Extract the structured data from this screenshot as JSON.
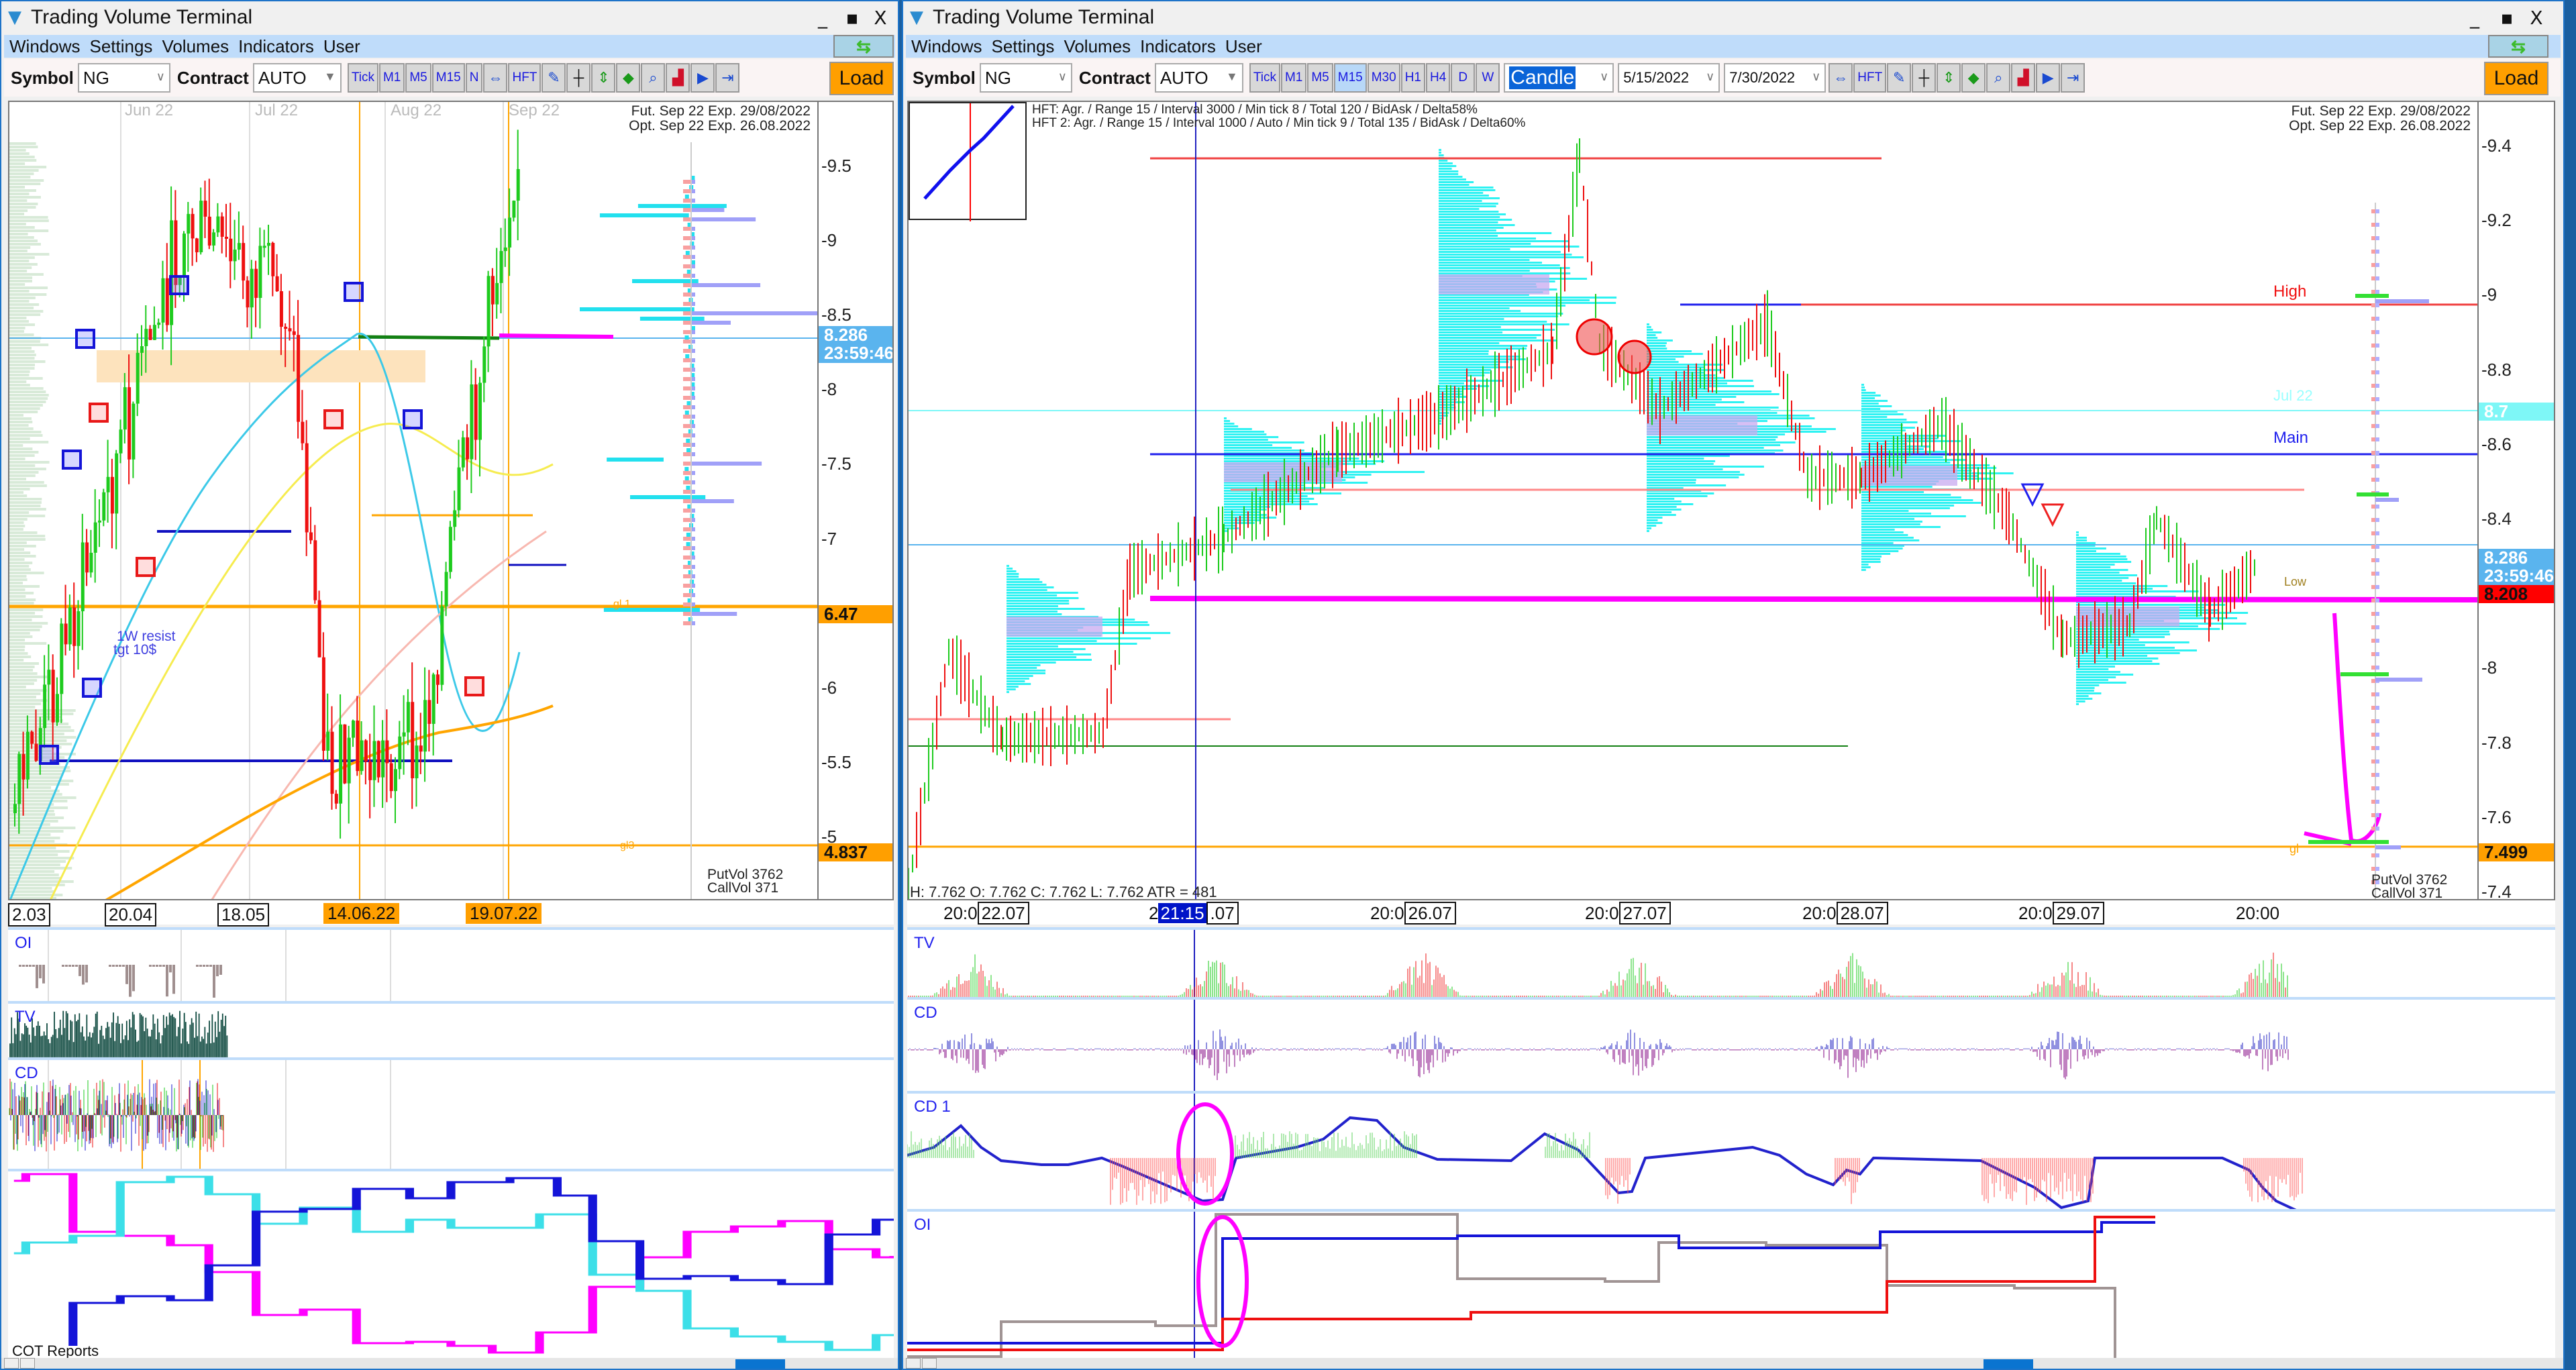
{
  "app_title": "Trading Volume Terminal",
  "window_controls": {
    "minimize": "_",
    "maximize": "▪",
    "close": "X"
  },
  "menu": [
    "Windows",
    "Settings",
    "Volumes",
    "Indicators",
    "User"
  ],
  "left": {
    "toolbar": {
      "symbol_label": "Symbol",
      "symbol_value": "NG",
      "contract_label": "Contract",
      "contract_value": "AUTO",
      "timeframes": [
        "Tick",
        "M1",
        "M5",
        "M15",
        "N"
      ],
      "hft_label": "HFT",
      "load_label": "Load"
    },
    "chart": {
      "month_labels": [
        "Jun 22",
        "Jul 22",
        "Aug 22",
        "Sep 22"
      ],
      "expiry_fut": "Fut. Sep 22 Exp. 29/08/2022",
      "expiry_opt": "Opt. Sep 22 Exp. 26.08.2022",
      "price_ticks": [
        "9.5",
        "9",
        "8.5",
        "8",
        "7.5",
        "7",
        "6.5",
        "6",
        "5.5",
        "5"
      ],
      "current_price": "8.286",
      "countdown": "23:59:46",
      "level_orange_1": "6.47",
      "level_orange_2": "4.837",
      "annotation_1": "1W resist",
      "annotation_2": "tgt 10$",
      "level_label_gl1": "gl 1",
      "level_label_gl3": "gl3",
      "put_vol": "PutVol  3762",
      "call_vol": "CallVol  371",
      "time_labels": [
        "2.03",
        "20.04",
        "18.05",
        "14.06.22",
        "19.07.22"
      ]
    },
    "panels": {
      "oi": "OI",
      "tv": "TV",
      "cd": "CD",
      "cot": "COT Reports"
    }
  },
  "right": {
    "toolbar": {
      "symbol_label": "Symbol",
      "symbol_value": "NG",
      "contract_label": "Contract",
      "contract_value": "AUTO",
      "timeframes": [
        "Tick",
        "M1",
        "M5",
        "M15",
        "M30",
        "H1",
        "H4",
        "D",
        "W"
      ],
      "active_timeframe": "M15",
      "chart_type": "Candle",
      "date_from": "5/15/2022",
      "date_to": "7/30/2022",
      "hft_label": "HFT",
      "load_label": "Load"
    },
    "chart": {
      "hft_line_1": "HFT: Agr. / Range 15 / Interval 3000 / Min tick 8 / Total 120 / BidAsk / Delta58%",
      "hft_line_2": "HFT 2: Agr. / Range 15 / Interval 1000 / Auto / Min tick 9 / Total 135 / BidAsk / Delta60%",
      "expiry_fut": "Fut. Sep 22 Exp. 29/08/2022",
      "expiry_opt": "Opt. Sep 22 Exp. 26.08.2022",
      "price_ticks": [
        "9.4",
        "9.2",
        "9",
        "8.8",
        "8.6",
        "8.4",
        "8.2",
        "8",
        "7.8",
        "7.6",
        "7.4"
      ],
      "level_high": "High",
      "level_jul": "Jul 22",
      "level_main": "Main",
      "level_low": "Low",
      "level_gl": "gl",
      "tag_87": "8.7",
      "current_price": "8.286",
      "countdown": "23:59:46",
      "level_red": "8.208",
      "level_orange": "7.499",
      "ohlc": "H: 7.762  O: 7.762  C: 7.762  L: 7.762  ATR = 481",
      "put_vol": "PutVol  3762",
      "call_vol": "CallVol  371",
      "time_labels": [
        {
          "pre": "20:0",
          "box": "22.07"
        },
        {
          "pre": "2",
          "sel": "21:15",
          "box": ".07"
        },
        {
          "pre": "20:0",
          "box": "26.07"
        },
        {
          "pre": "20:0",
          "box": "27.07"
        },
        {
          "pre": "20:0",
          "box": "28.07"
        },
        {
          "pre": "20:0",
          "box": "29.07"
        },
        {
          "pre": "20:00",
          "box": ""
        }
      ]
    },
    "panels": {
      "tv": "TV",
      "cd": "CD",
      "cd1": "CD 1",
      "oi": "OI"
    }
  },
  "colors": {
    "accent_blue": "#1d73c8",
    "menu_bg": "#bfdcfa",
    "load_orange": "#ff9f00",
    "price_tag_blue": "#5ab4ee",
    "price_tag_red": "#ff0000",
    "cyan_profile": "#2ef2f2",
    "magenta": "#ff00ff"
  }
}
